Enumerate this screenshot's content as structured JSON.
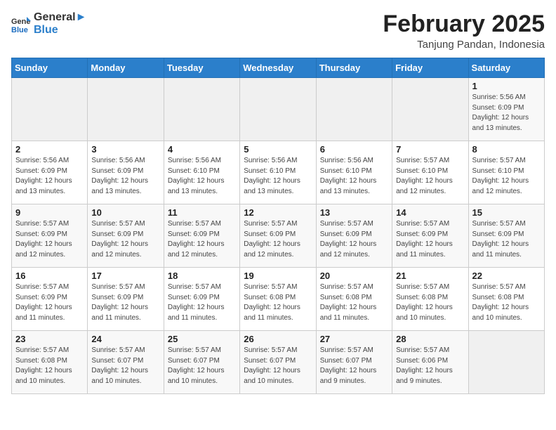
{
  "logo": {
    "general": "General",
    "blue": "Blue"
  },
  "title": "February 2025",
  "subtitle": "Tanjung Pandan, Indonesia",
  "days_of_week": [
    "Sunday",
    "Monday",
    "Tuesday",
    "Wednesday",
    "Thursday",
    "Friday",
    "Saturday"
  ],
  "weeks": [
    [
      {
        "day": "",
        "info": ""
      },
      {
        "day": "",
        "info": ""
      },
      {
        "day": "",
        "info": ""
      },
      {
        "day": "",
        "info": ""
      },
      {
        "day": "",
        "info": ""
      },
      {
        "day": "",
        "info": ""
      },
      {
        "day": "1",
        "info": "Sunrise: 5:56 AM\nSunset: 6:09 PM\nDaylight: 12 hours\nand 13 minutes."
      }
    ],
    [
      {
        "day": "2",
        "info": "Sunrise: 5:56 AM\nSunset: 6:09 PM\nDaylight: 12 hours\nand 13 minutes."
      },
      {
        "day": "3",
        "info": "Sunrise: 5:56 AM\nSunset: 6:09 PM\nDaylight: 12 hours\nand 13 minutes."
      },
      {
        "day": "4",
        "info": "Sunrise: 5:56 AM\nSunset: 6:10 PM\nDaylight: 12 hours\nand 13 minutes."
      },
      {
        "day": "5",
        "info": "Sunrise: 5:56 AM\nSunset: 6:10 PM\nDaylight: 12 hours\nand 13 minutes."
      },
      {
        "day": "6",
        "info": "Sunrise: 5:56 AM\nSunset: 6:10 PM\nDaylight: 12 hours\nand 13 minutes."
      },
      {
        "day": "7",
        "info": "Sunrise: 5:57 AM\nSunset: 6:10 PM\nDaylight: 12 hours\nand 12 minutes."
      },
      {
        "day": "8",
        "info": "Sunrise: 5:57 AM\nSunset: 6:10 PM\nDaylight: 12 hours\nand 12 minutes."
      }
    ],
    [
      {
        "day": "9",
        "info": "Sunrise: 5:57 AM\nSunset: 6:09 PM\nDaylight: 12 hours\nand 12 minutes."
      },
      {
        "day": "10",
        "info": "Sunrise: 5:57 AM\nSunset: 6:09 PM\nDaylight: 12 hours\nand 12 minutes."
      },
      {
        "day": "11",
        "info": "Sunrise: 5:57 AM\nSunset: 6:09 PM\nDaylight: 12 hours\nand 12 minutes."
      },
      {
        "day": "12",
        "info": "Sunrise: 5:57 AM\nSunset: 6:09 PM\nDaylight: 12 hours\nand 12 minutes."
      },
      {
        "day": "13",
        "info": "Sunrise: 5:57 AM\nSunset: 6:09 PM\nDaylight: 12 hours\nand 12 minutes."
      },
      {
        "day": "14",
        "info": "Sunrise: 5:57 AM\nSunset: 6:09 PM\nDaylight: 12 hours\nand 11 minutes."
      },
      {
        "day": "15",
        "info": "Sunrise: 5:57 AM\nSunset: 6:09 PM\nDaylight: 12 hours\nand 11 minutes."
      }
    ],
    [
      {
        "day": "16",
        "info": "Sunrise: 5:57 AM\nSunset: 6:09 PM\nDaylight: 12 hours\nand 11 minutes."
      },
      {
        "day": "17",
        "info": "Sunrise: 5:57 AM\nSunset: 6:09 PM\nDaylight: 12 hours\nand 11 minutes."
      },
      {
        "day": "18",
        "info": "Sunrise: 5:57 AM\nSunset: 6:09 PM\nDaylight: 12 hours\nand 11 minutes."
      },
      {
        "day": "19",
        "info": "Sunrise: 5:57 AM\nSunset: 6:08 PM\nDaylight: 12 hours\nand 11 minutes."
      },
      {
        "day": "20",
        "info": "Sunrise: 5:57 AM\nSunset: 6:08 PM\nDaylight: 12 hours\nand 11 minutes."
      },
      {
        "day": "21",
        "info": "Sunrise: 5:57 AM\nSunset: 6:08 PM\nDaylight: 12 hours\nand 10 minutes."
      },
      {
        "day": "22",
        "info": "Sunrise: 5:57 AM\nSunset: 6:08 PM\nDaylight: 12 hours\nand 10 minutes."
      }
    ],
    [
      {
        "day": "23",
        "info": "Sunrise: 5:57 AM\nSunset: 6:08 PM\nDaylight: 12 hours\nand 10 minutes."
      },
      {
        "day": "24",
        "info": "Sunrise: 5:57 AM\nSunset: 6:07 PM\nDaylight: 12 hours\nand 10 minutes."
      },
      {
        "day": "25",
        "info": "Sunrise: 5:57 AM\nSunset: 6:07 PM\nDaylight: 12 hours\nand 10 minutes."
      },
      {
        "day": "26",
        "info": "Sunrise: 5:57 AM\nSunset: 6:07 PM\nDaylight: 12 hours\nand 10 minutes."
      },
      {
        "day": "27",
        "info": "Sunrise: 5:57 AM\nSunset: 6:07 PM\nDaylight: 12 hours\nand 9 minutes."
      },
      {
        "day": "28",
        "info": "Sunrise: 5:57 AM\nSunset: 6:06 PM\nDaylight: 12 hours\nand 9 minutes."
      },
      {
        "day": "",
        "info": ""
      }
    ]
  ]
}
